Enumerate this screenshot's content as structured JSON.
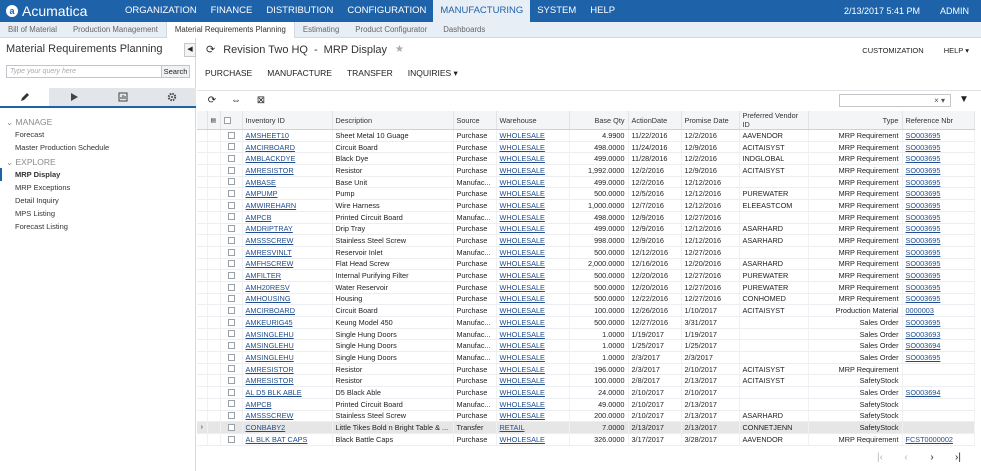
{
  "brand": {
    "name": "Acumatica"
  },
  "nav": {
    "items": [
      "ORGANIZATION",
      "FINANCE",
      "DISTRIBUTION",
      "CONFIGURATION",
      "MANUFACTURING",
      "SYSTEM",
      "HELP"
    ],
    "active": "MANUFACTURING",
    "datetime": "2/13/2017  5:41 PM",
    "user": "ADMIN"
  },
  "subtabs": {
    "items": [
      "Bill of Material",
      "Production Management",
      "Material Requirements Planning",
      "Estimating",
      "Product Configurator",
      "Dashboards"
    ],
    "active": "Material Requirements Planning"
  },
  "sidebar": {
    "title": "Material Requirements Planning",
    "search_placeholder": "Type your query here",
    "search_button": "Search",
    "groups": [
      {
        "title": "MANAGE",
        "items": [
          "Forecast",
          "Master Production Schedule"
        ]
      },
      {
        "title": "EXPLORE",
        "items": [
          "MRP Display",
          "MRP Exceptions",
          "Detail Inquiry",
          "MPS Listing",
          "Forecast Listing"
        ]
      }
    ],
    "active_item": "MRP Display"
  },
  "page": {
    "company": "Revision Two HQ",
    "separator": "-",
    "title": "MRP Display",
    "customization": "CUSTOMIZATION",
    "help": "HELP ▾"
  },
  "actions": [
    "PURCHASE",
    "MANUFACTURE",
    "TRANSFER",
    "INQUIRIES ▾"
  ],
  "grid_search": {
    "clear": "×",
    "caret": "▾"
  },
  "columns": [
    "Inventory ID",
    "Description",
    "Source",
    "Warehouse",
    "Base Qty",
    "ActionDate",
    "Promise Date",
    "Preferred Vendor ID",
    "Type",
    "Reference Nbr"
  ],
  "rows": [
    [
      "AMSHEET10",
      "Sheet Metal 10 Guage",
      "Purchase",
      "WHOLESALE",
      "4.9900",
      "11/22/2016",
      "12/2/2016",
      "AAVENDOR",
      "MRP Requirement",
      "SO003695"
    ],
    [
      "AMCIRBOARD",
      "Circuit Board",
      "Purchase",
      "WHOLESALE",
      "498.0000",
      "11/24/2016",
      "12/9/2016",
      "ACITAISYST",
      "MRP Requirement",
      "SO003695"
    ],
    [
      "AMBLACKDYE",
      "Black Dye",
      "Purchase",
      "WHOLESALE",
      "499.0000",
      "11/28/2016",
      "12/2/2016",
      "INDGLOBAL",
      "MRP Requirement",
      "SO003695"
    ],
    [
      "AMRESISTOR",
      "Resistor",
      "Purchase",
      "WHOLESALE",
      "1,992.0000",
      "12/2/2016",
      "12/9/2016",
      "ACITAISYST",
      "MRP Requirement",
      "SO003695"
    ],
    [
      "AMBASE",
      "Base Unit",
      "Manufac...",
      "WHOLESALE",
      "499.0000",
      "12/2/2016",
      "12/12/2016",
      "",
      "MRP Requirement",
      "SO003695"
    ],
    [
      "AMPUMP",
      "Pump",
      "Purchase",
      "WHOLESALE",
      "500.0000",
      "12/5/2016",
      "12/12/2016",
      "PUREWATER",
      "MRP Requirement",
      "SO003695"
    ],
    [
      "AMWIREHARN",
      "Wire Harness",
      "Purchase",
      "WHOLESALE",
      "1,000.0000",
      "12/7/2016",
      "12/12/2016",
      "ELEEASTCOM",
      "MRP Requirement",
      "SO003695"
    ],
    [
      "AMPCB",
      "Printed Circuit Board",
      "Manufac...",
      "WHOLESALE",
      "498.0000",
      "12/9/2016",
      "12/27/2016",
      "",
      "MRP Requirement",
      "SO003695"
    ],
    [
      "AMDRIPTRAY",
      "Drip Tray",
      "Purchase",
      "WHOLESALE",
      "499.0000",
      "12/9/2016",
      "12/12/2016",
      "ASARHARD",
      "MRP Requirement",
      "SO003695"
    ],
    [
      "AMSSSCREW",
      "Stainless Steel Screw",
      "Purchase",
      "WHOLESALE",
      "998.0000",
      "12/9/2016",
      "12/12/2016",
      "ASARHARD",
      "MRP Requirement",
      "SO003695"
    ],
    [
      "AMRESVINLT",
      "Reservoir Inlet",
      "Manufac...",
      "WHOLESALE",
      "500.0000",
      "12/12/2016",
      "12/27/2016",
      "",
      "MRP Requirement",
      "SO003695"
    ],
    [
      "AMFHSCREW",
      "Flat Head Screw",
      "Purchase",
      "WHOLESALE",
      "2,000.0000",
      "12/16/2016",
      "12/20/2016",
      "ASARHARD",
      "MRP Requirement",
      "SO003695"
    ],
    [
      "AMFILTER",
      "Internal Purifying Filter",
      "Purchase",
      "WHOLESALE",
      "500.0000",
      "12/20/2016",
      "12/27/2016",
      "PUREWATER",
      "MRP Requirement",
      "SO003695"
    ],
    [
      "AMH20RESV",
      "Water Reservoir",
      "Purchase",
      "WHOLESALE",
      "500.0000",
      "12/20/2016",
      "12/27/2016",
      "PUREWATER",
      "MRP Requirement",
      "SO003695"
    ],
    [
      "AMHOUSING",
      "Housing",
      "Purchase",
      "WHOLESALE",
      "500.0000",
      "12/22/2016",
      "12/27/2016",
      "CONHOMED",
      "MRP Requirement",
      "SO003695"
    ],
    [
      "AMCIRBOARD",
      "Circuit Board",
      "Purchase",
      "WHOLESALE",
      "100.0000",
      "12/26/2016",
      "1/10/2017",
      "ACITAISYST",
      "Production Material",
      "0000003"
    ],
    [
      "AMKEURIG45",
      "Keung Model 450",
      "Manufac...",
      "WHOLESALE",
      "500.0000",
      "12/27/2016",
      "3/31/2017",
      "",
      "Sales Order",
      "SO003695"
    ],
    [
      "AMSINGLEHU",
      "Single Hung Doors",
      "Manufac...",
      "WHOLESALE",
      "1.0000",
      "1/19/2017",
      "1/19/2017",
      "",
      "Sales Order",
      "SO003693"
    ],
    [
      "AMSINGLEHU",
      "Single Hung Doors",
      "Manufac...",
      "WHOLESALE",
      "1.0000",
      "1/25/2017",
      "1/25/2017",
      "",
      "Sales Order",
      "SO003694"
    ],
    [
      "AMSINGLEHU",
      "Single Hung Doors",
      "Manufac...",
      "WHOLESALE",
      "1.0000",
      "2/3/2017",
      "2/3/2017",
      "",
      "Sales Order",
      "SO003695"
    ],
    [
      "AMRESISTOR",
      "Resistor",
      "Purchase",
      "WHOLESALE",
      "196.0000",
      "2/3/2017",
      "2/10/2017",
      "ACITAISYST",
      "MRP Requirement",
      ""
    ],
    [
      "AMRESISTOR",
      "Resistor",
      "Purchase",
      "WHOLESALE",
      "100.0000",
      "2/8/2017",
      "2/13/2017",
      "ACITAISYST",
      "SafetyStock",
      ""
    ],
    [
      "AL D5 BLK ABLE",
      "D5 Black Able",
      "Purchase",
      "WHOLESALE",
      "24.0000",
      "2/10/2017",
      "2/10/2017",
      "",
      "Sales Order",
      "SO003694"
    ],
    [
      "AMPCB",
      "Printed Circuit Board",
      "Manufac...",
      "WHOLESALE",
      "49.0000",
      "2/10/2017",
      "2/13/2017",
      "",
      "SafetyStock",
      ""
    ],
    [
      "AMSSSCREW",
      "Stainless Steel Screw",
      "Purchase",
      "WHOLESALE",
      "200.0000",
      "2/10/2017",
      "2/13/2017",
      "ASARHARD",
      "SafetyStock",
      ""
    ],
    [
      "CONBABY2",
      "Little Tikes Bold n Bright Table & ...",
      "Transfer",
      "RETAIL",
      "7.0000",
      "2/13/2017",
      "2/13/2017",
      "CONNETJENN",
      "SafetyStock",
      ""
    ],
    [
      "AL BLK BAT CAPS",
      "Black Battle Caps",
      "Purchase",
      "WHOLESALE",
      "326.0000",
      "3/17/2017",
      "3/28/2017",
      "AAVENDOR",
      "MRP Requirement",
      "FCST0000002"
    ]
  ],
  "selected_row": 25,
  "pager": [
    "|‹",
    "‹",
    "›",
    "›|"
  ]
}
